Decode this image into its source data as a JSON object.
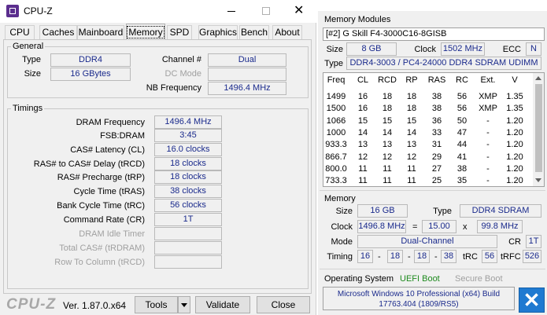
{
  "window": {
    "title": "CPU-Z",
    "min_icon": "minimize-icon",
    "max_icon": "maximize-icon",
    "close_icon": "close-icon",
    "app_icon": "cpuz-app-icon"
  },
  "tabs": [
    {
      "label": "CPU",
      "active": false
    },
    {
      "label": "Caches",
      "active": false
    },
    {
      "label": "Mainboard",
      "active": false
    },
    {
      "label": "Memory",
      "active": true
    },
    {
      "label": "SPD",
      "active": false
    },
    {
      "label": "Graphics",
      "active": false
    },
    {
      "label": "Bench",
      "active": false
    },
    {
      "label": "About",
      "active": false
    }
  ],
  "general": {
    "title": "General",
    "type_label": "Type",
    "type_value": "DDR4",
    "size_label": "Size",
    "size_value": "16 GBytes",
    "channel_label": "Channel #",
    "channel_value": "Dual",
    "dcmode_label": "DC Mode",
    "dcmode_value": "",
    "nbfreq_label": "NB Frequency",
    "nbfreq_value": "1496.4 MHz"
  },
  "timings": {
    "title": "Timings",
    "rows": [
      {
        "label": "DRAM Frequency",
        "value": "1496.4 MHz",
        "enabled": true
      },
      {
        "label": "FSB:DRAM",
        "value": "3:45",
        "enabled": true
      },
      {
        "label": "CAS# Latency (CL)",
        "value": "16.0 clocks",
        "enabled": true
      },
      {
        "label": "RAS# to CAS# Delay (tRCD)",
        "value": "18 clocks",
        "enabled": true
      },
      {
        "label": "RAS# Precharge (tRP)",
        "value": "18 clocks",
        "enabled": true
      },
      {
        "label": "Cycle Time (tRAS)",
        "value": "38 clocks",
        "enabled": true
      },
      {
        "label": "Bank Cycle Time (tRC)",
        "value": "56 clocks",
        "enabled": true
      },
      {
        "label": "Command Rate (CR)",
        "value": "1T",
        "enabled": true
      },
      {
        "label": "DRAM Idle Timer",
        "value": "",
        "enabled": false
      },
      {
        "label": "Total CAS# (tRDRAM)",
        "value": "",
        "enabled": false
      },
      {
        "label": "Row To Column (tRCD)",
        "value": "",
        "enabled": false
      }
    ]
  },
  "footer": {
    "logo": "CPU-Z",
    "version": "Ver. 1.87.0.x64",
    "tools_label": "Tools",
    "validate_label": "Validate",
    "close_label": "Close"
  },
  "modules": {
    "title": "Memory Modules",
    "selected": "[#2] G Skill F4-3000C16-8GISB",
    "size_label": "Size",
    "size_value": "8 GB",
    "clock_label": "Clock",
    "clock_value": "1502 MHz",
    "ecc_label": "ECC",
    "ecc_value": "N",
    "type_label": "Type",
    "type_value": "DDR4-3003 / PC4-24000 DDR4 SDRAM UDIMM",
    "columns": [
      "Freq",
      "CL",
      "RCD",
      "RP",
      "RAS",
      "RC",
      "Ext.",
      "V"
    ],
    "rows": [
      [
        "1499",
        "16",
        "18",
        "18",
        "38",
        "56",
        "XMP",
        "1.35"
      ],
      [
        "1500",
        "16",
        "18",
        "18",
        "38",
        "56",
        "XMP",
        "1.35"
      ],
      [
        "1066",
        "15",
        "15",
        "15",
        "36",
        "50",
        "-",
        "1.20"
      ],
      [
        "1000",
        "14",
        "14",
        "14",
        "33",
        "47",
        "-",
        "1.20"
      ],
      [
        "933.3",
        "13",
        "13",
        "13",
        "31",
        "44",
        "-",
        "1.20"
      ],
      [
        "866.7",
        "12",
        "12",
        "12",
        "29",
        "41",
        "-",
        "1.20"
      ],
      [
        "800.0",
        "11",
        "11",
        "11",
        "27",
        "38",
        "-",
        "1.20"
      ],
      [
        "733.3",
        "11",
        "11",
        "11",
        "25",
        "35",
        "-",
        "1.20"
      ]
    ]
  },
  "memory": {
    "title": "Memory",
    "size_label": "Size",
    "size_value": "16 GB",
    "type_label": "Type",
    "type_value": "DDR4 SDRAM",
    "clock_label": "Clock",
    "clock_value": "1496.8 MHz",
    "eq": "=",
    "mult_value": "15.00",
    "x": "x",
    "bus_value": "99.8 MHz",
    "mode_label": "Mode",
    "mode_value": "Dual-Channel",
    "cr_label": "CR",
    "cr_value": "1T",
    "timing_label": "Timing",
    "t1": "16",
    "t2": "18",
    "t3": "18",
    "t4": "38",
    "dash": "-",
    "trc_label": "tRC",
    "trc_value": "56",
    "trfc_label": "tRFC",
    "trfc_value": "526"
  },
  "os": {
    "label": "Operating System",
    "uefi": "UEFI Boot",
    "secure": "Secure Boot",
    "name": "Microsoft Windows 10 Professional (x64) Build",
    "build": "17763.404 (1809/RS5)"
  }
}
